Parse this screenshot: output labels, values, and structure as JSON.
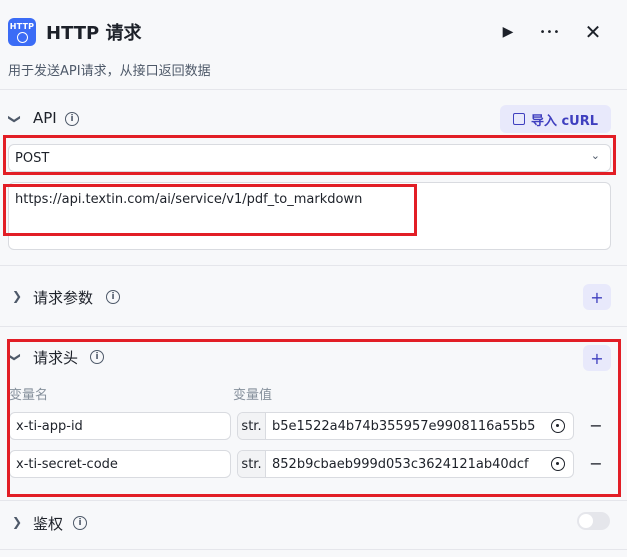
{
  "header": {
    "icon_text": "HTTP",
    "title": "HTTP 请求",
    "subtitle": "用于发送API请求，从接口返回数据",
    "run_icon": "▶",
    "more_icon": "•••",
    "close_icon": "✕"
  },
  "api": {
    "title": "API",
    "import_label": "导入 cURL",
    "method": "POST",
    "url": "https://api.textin.com/ai/service/v1/pdf_to_markdown"
  },
  "params": {
    "title": "请求参数"
  },
  "headers": {
    "title": "请求头",
    "col_name": "变量名",
    "col_value": "变量值",
    "rows": [
      {
        "name": "x-ti-app-id",
        "type": "str.",
        "value": "b5e1522a4b74b355957e9908116a55b5"
      },
      {
        "name": "x-ti-secret-code",
        "type": "str.",
        "value": "852b9cbaeb999d053c3624121ab40dcf"
      }
    ]
  },
  "auth": {
    "title": "鉴权",
    "enabled": false
  },
  "icons": {
    "info": "i",
    "plus": "+",
    "minus": "−",
    "chevron_right": "❯",
    "chevron_down": "❯",
    "caret": "⌄"
  },
  "colors": {
    "accent": "#3b6cf6",
    "highlight": "#e21e26",
    "plus_bg": "#e8e9fb"
  }
}
